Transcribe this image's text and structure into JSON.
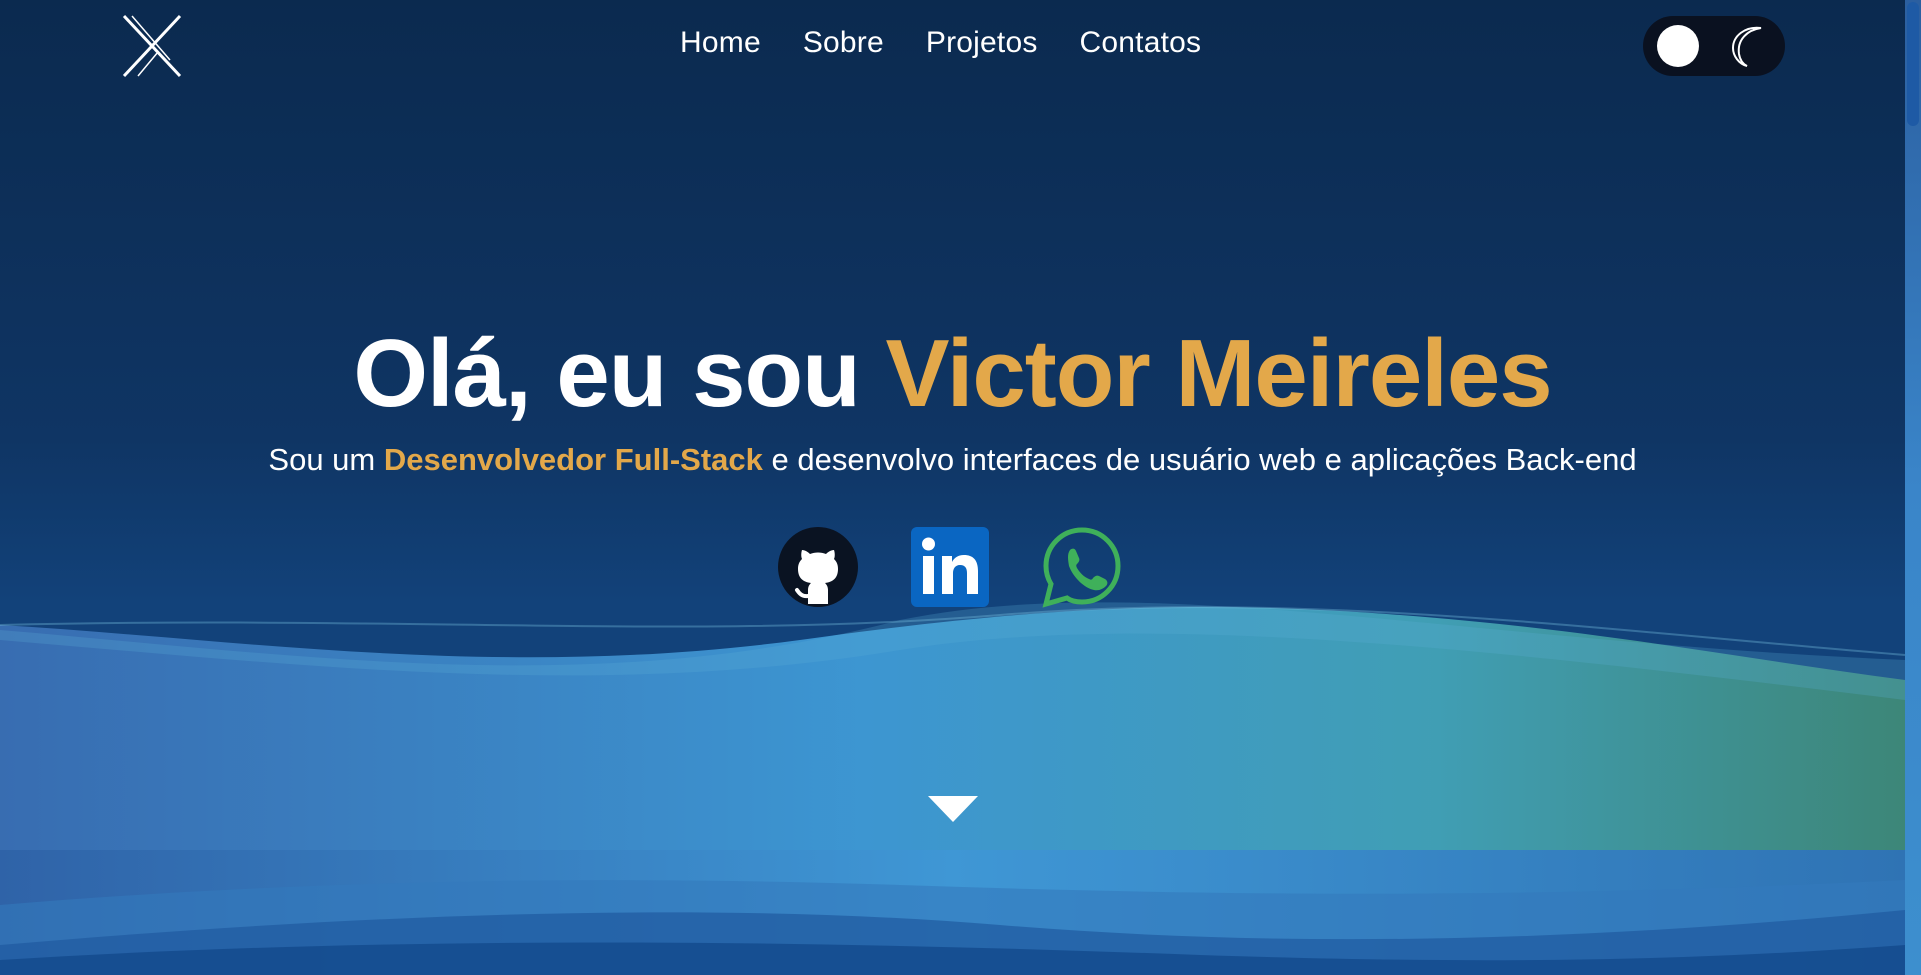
{
  "nav": {
    "items": [
      "Home",
      "Sobre",
      "Projetos",
      "Contatos"
    ]
  },
  "logo": {
    "icon": "x-logo-icon"
  },
  "theme_toggle": {
    "knob_icon": "sun-circle-icon",
    "moon_icon": "moon-icon"
  },
  "hero": {
    "title_prefix": "Olá, eu sou ",
    "title_name": "Victor Meireles",
    "subtitle_prefix": "Sou um ",
    "subtitle_role": "Desenvolvedor Full-Stack",
    "subtitle_suffix": " e desenvolvo interfaces de usuário web e aplicações Back-end"
  },
  "socials": [
    {
      "name": "github-icon"
    },
    {
      "name": "linkedin-icon"
    },
    {
      "name": "whatsapp-icon"
    }
  ],
  "colors": {
    "accent": "#e3a84a",
    "background": "#0b2a4f",
    "toggle_bg": "#0a1120"
  }
}
